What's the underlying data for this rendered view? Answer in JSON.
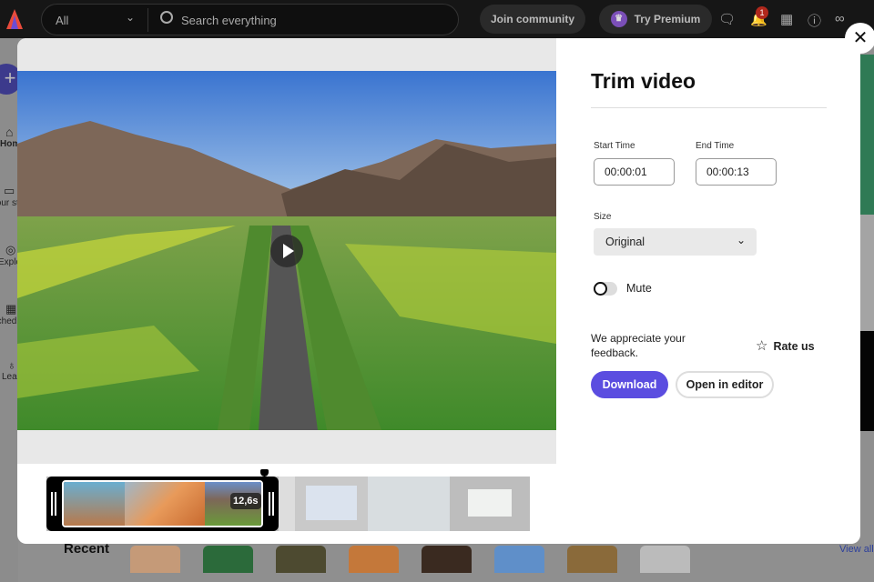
{
  "topbar": {
    "search_scope": "All",
    "search_placeholder": "Search everything",
    "join": "Join community",
    "premium": "Try Premium",
    "notif_count": "1"
  },
  "sidebar": {
    "items": [
      "Home",
      "Your stuff",
      "Explore",
      "Schedule",
      "Learn"
    ]
  },
  "background": {
    "recent": "Recent",
    "view_all": "View all"
  },
  "trim": {
    "title": "Trim video",
    "start_label": "Start Time",
    "start_value": "00:00:01",
    "end_label": "End Time",
    "end_value": "00:00:13",
    "size_label": "Size",
    "size_value": "Original",
    "mute_label": "Mute",
    "mute_on": false,
    "feedback": "We appreciate your feedback.",
    "rate": "Rate us",
    "download": "Download",
    "open_editor": "Open in editor",
    "duration": "12,6s"
  },
  "colors": {
    "accent": "#5b4de0",
    "topbar": "#161616"
  }
}
